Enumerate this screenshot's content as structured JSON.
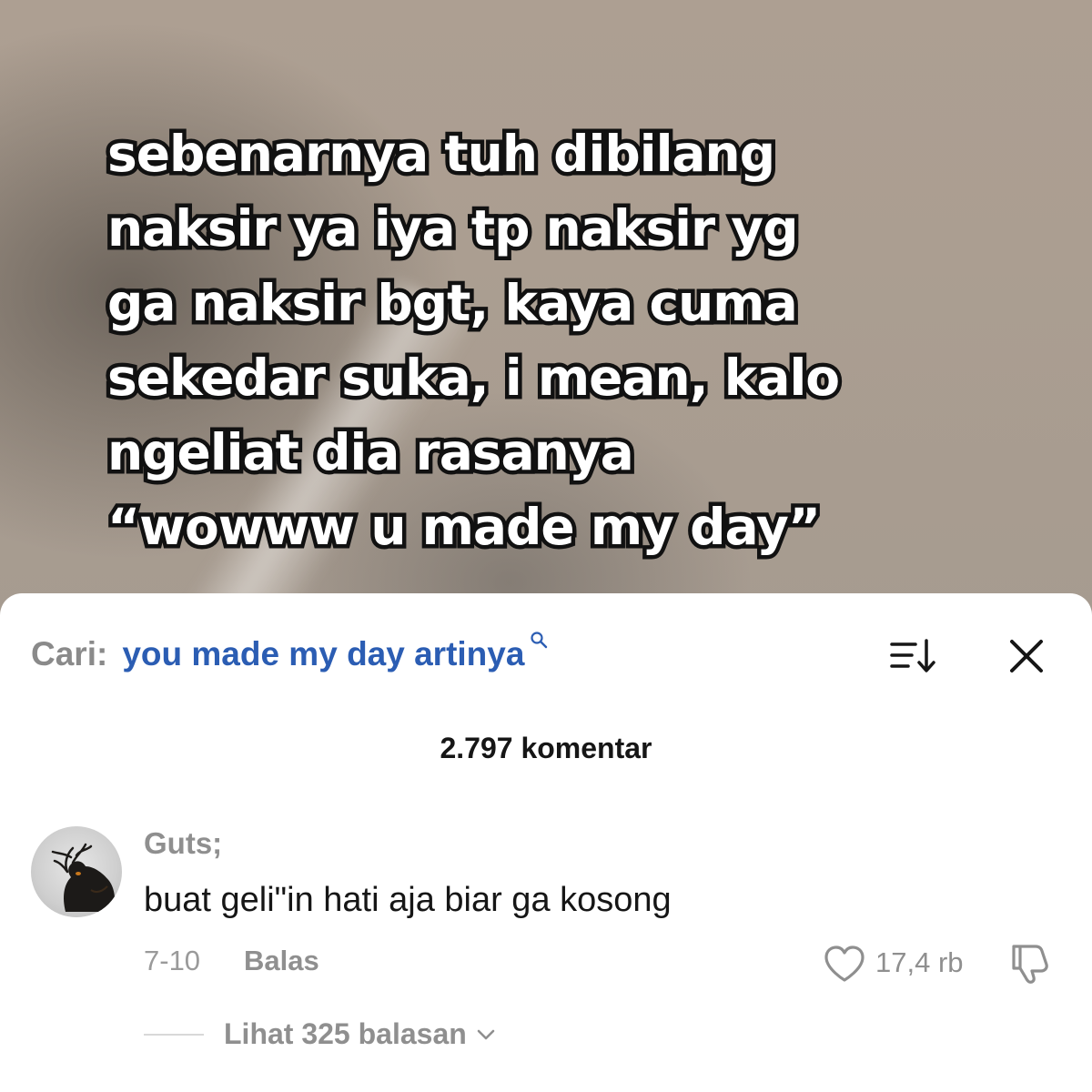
{
  "video": {
    "caption": "sebenarnya tuh dibilang\nnaksir ya iya tp naksir yg\nga naksir bgt, kaya cuma\nsekedar suka, i mean, kalo\nngeliat dia rasanya\n“wowww u made my day”"
  },
  "comments_sheet": {
    "search": {
      "prefix": "Cari:",
      "query": "you made my day artinya",
      "icon": "search-icon",
      "color": "#2b5db3"
    },
    "sort_icon": "sort-icon",
    "close_icon": "close-icon",
    "count_label": "2.797 komentar",
    "comments": [
      {
        "avatar_icon": "avatar",
        "username": "Guts;",
        "text": "buat geli\"in hati aja biar ga kosong",
        "date": "7-10",
        "reply_label": "Balas",
        "likes": "17,4 rb",
        "like_icon": "heart-icon",
        "dislike_icon": "dislike-icon",
        "view_replies_label": "Lihat 325 balasan"
      }
    ]
  }
}
